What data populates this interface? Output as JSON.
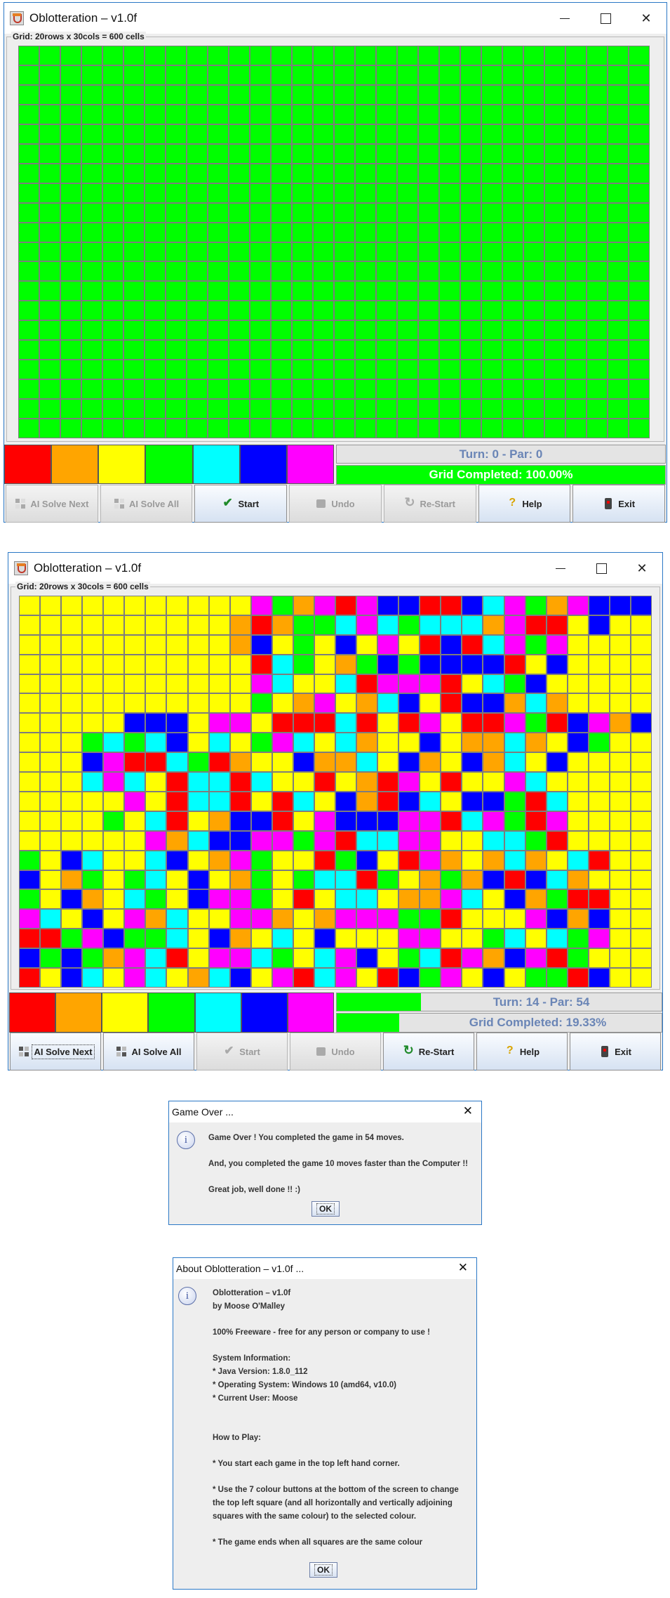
{
  "colors": {
    "palette": [
      "#ff0000",
      "#ffa500",
      "#ffff00",
      "#00ff00",
      "#00ffff",
      "#0000ff",
      "#ff00ff"
    ]
  },
  "window1": {
    "title": "Oblotteration – v1.0f",
    "grid_label": "Grid: 20rows x 30cols  = 600 cells",
    "turn_text": "Turn: 0  - Par: 0",
    "completed_text": "Grid Completed: 100.00%",
    "completed_fraction": 1.0,
    "buttons": [
      {
        "label": "AI Solve Next",
        "icon": "ai-solve-icon",
        "enabled": false
      },
      {
        "label": "AI Solve All",
        "icon": "ai-solve-all-icon",
        "enabled": false
      },
      {
        "label": "Start",
        "icon": "checkmark-icon",
        "enabled": true
      },
      {
        "label": "Undo",
        "icon": "undo-icon",
        "enabled": false
      },
      {
        "label": "Re-Start",
        "icon": "restart-icon",
        "enabled": false
      },
      {
        "label": "Help",
        "icon": "help-icon",
        "enabled": true
      },
      {
        "label": "Exit",
        "icon": "exit-icon",
        "enabled": true
      }
    ],
    "grid_rows": [
      "GGGGGGGGGGGGGGGGGGGGGGGGGGGGGG",
      "GGGGGGGGGGGGGGGGGGGGGGGGGGGGGG",
      "GGGGGGGGGGGGGGGGGGGGGGGGGGGGGG",
      "GGGGGGGGGGGGGGGGGGGGGGGGGGGGGG",
      "GGGGGGGGGGGGGGGGGGGGGGGGGGGGGG",
      "GGGGGGGGGGGGGGGGGGGGGGGGGGGGGG",
      "GGGGGGGGGGGGGGGGGGGGGGGGGGGGGG",
      "GGGGGGGGGGGGGGGGGGGGGGGGGGGGGG",
      "GGGGGGGGGGGGGGGGGGGGGGGGGGGGGG",
      "GGGGGGGGGGGGGGGGGGGGGGGGGGGGGG",
      "GGGGGGGGGGGGGGGGGGGGGGGGGGGGGG",
      "GGGGGGGGGGGGGGGGGGGGGGGGGGGGGG",
      "GGGGGGGGGGGGGGGGGGGGGGGGGGGGGG",
      "GGGGGGGGGGGGGGGGGGGGGGGGGGGGGG",
      "GGGGGGGGGGGGGGGGGGGGGGGGGGGGGG",
      "GGGGGGGGGGGGGGGGGGGGGGGGGGGGGG",
      "GGGGGGGGGGGGGGGGGGGGGGGGGGGGGG",
      "GGGGGGGGGGGGGGGGGGGGGGGGGGGGGG",
      "GGGGGGGGGGGGGGGGGGGGGGGGGGGGGG",
      "GGGGGGGGGGGGGGGGGGGGGGGGGGGGGG"
    ]
  },
  "window2": {
    "title": "Oblotteration – v1.0f",
    "grid_label": "Grid: 20rows x 30cols  = 600 cells",
    "turn_text": "Turn: 14  - Par: 54",
    "turn_progress_fraction": 0.26,
    "completed_text": "Grid Completed: 19.33%",
    "completed_fraction": 0.1933,
    "buttons": [
      {
        "label": "AI Solve Next",
        "icon": "ai-solve-icon",
        "enabled": true,
        "focused": true
      },
      {
        "label": "AI Solve All",
        "icon": "ai-solve-all-icon",
        "enabled": true
      },
      {
        "label": "Start",
        "icon": "checkmark-icon",
        "enabled": false
      },
      {
        "label": "Undo",
        "icon": "undo-icon",
        "enabled": false
      },
      {
        "label": "Re-Start",
        "icon": "restart-icon",
        "enabled": true
      },
      {
        "label": "Help",
        "icon": "help-icon",
        "enabled": true
      },
      {
        "label": "Exit",
        "icon": "exit-icon",
        "enabled": true
      }
    ],
    "grid_rows": [
      "YYYYYYYYYYYMGOMRMBBRRBCMGOMBBB",
      "YYYYYYYYYYOROGGCMCGCCCOMRRYB",
      "YYYYYYYYYYOBYGYBYMYRBRCMGM",
      "YYYYYYYYYYYRCGYOGBGBBBBRYB",
      "YYYYYYYYYYYMCYYCRMMMRYCGBY",
      "YYYYYYYYYYYGYOMYOCBYRBBOCO",
      "YYYYYBBBYMMYRRRCRYRMYRRMGRBMOB",
      "YYYGCGCBYCYGMCYCOYYBYOOCOYBG",
      "YYYBMRRCGROYYBOOCYBOYBOCYB",
      "YYYCMCYRCCRCYYRYORMYRYYMCY",
      "YYYYYMYRCCRYRCYBORBCYBBGRC",
      "YYYYGYCRYOBBRYMBBBMMRCMGRM",
      "YYYYYYMOCBBMMGMRCCMMYYCCGR",
      "GYBCYYCBYOMGYYRGBYRMOYOCOYCR",
      "BYOGYGCYBYOGYGCCRGYOGOBRBCO",
      "GYBOYCGYBMMGYRYCCYOOMCYBOGRR",
      "MCYBYMOCYYMMOYOMMMGGRYYYMBOB",
      "RRGMBGGCYBOYCYBYYYMMYYGCYCGM",
      "BGBGOMCRYMMCGYCMBYGCRMOBMRGY",
      "RYBCYMCYOCBYMRCMYRBGMYBYGGRB"
    ]
  },
  "game_over_dialog": {
    "title": "Game Over ...",
    "lines": [
      "Game Over !  You completed the game in 54 moves.",
      "",
      "And, you completed the game 10 moves faster than the Computer !!",
      "",
      "Great job, well done !! :)"
    ],
    "ok_label": "OK"
  },
  "about_dialog": {
    "title": "About Oblotteration – v1.0f ...",
    "lines": [
      "Oblotteration – v1.0f",
      "by Moose O'Malley",
      "",
      "100% Freeware - free for any person or company to use !",
      "",
      "System Information:",
      "* Java Version: 1.8.0_112",
      "* Operating System: Windows 10 (amd64, v10.0)",
      "* Current User: Moose",
      "",
      "",
      "How to Play:",
      "",
      "* You start each game in the top left hand corner.",
      "",
      "* Use the 7 colour buttons at the bottom of the screen to change",
      "the top left square (and all horizontally and vertically adjoining",
      "squares with the same colour) to the selected colour.",
      "",
      "* The game ends when all squares are the same colour"
    ],
    "ok_label": "OK"
  }
}
